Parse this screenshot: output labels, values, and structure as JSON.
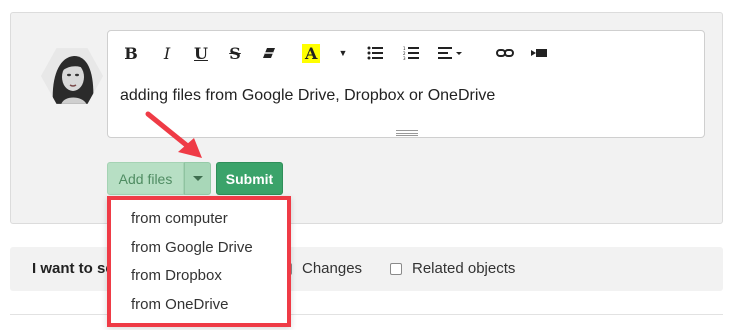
{
  "editor": {
    "text": "adding files from Google Drive, Dropbox or OneDrive",
    "toolbar": {
      "bold": "B",
      "italic": "I",
      "underline": "U",
      "strikethrough": "S",
      "highlight": "A",
      "eraser_icon": "eraser-icon",
      "bulleted_list_icon": "bulleted-list-icon",
      "numbered_list_icon": "numbered-list-icon",
      "align_icon": "align-icon",
      "link_icon": "link-icon",
      "video_icon": "video-icon",
      "highlight_color": "#ffff00"
    }
  },
  "actions": {
    "add_files_label": "Add files",
    "submit_label": "Submit",
    "add_files_color": "#b7dfc4",
    "submit_color": "#3ba36a"
  },
  "dropdown": {
    "items": [
      "from computer",
      "from Google Drive",
      "from Dropbox",
      "from OneDrive"
    ],
    "highlight_border_color": "#ef3b46"
  },
  "filters": {
    "label": "I want to se",
    "options": [
      {
        "label": "Changes",
        "checked": false
      },
      {
        "label": "Related objects",
        "checked": false
      }
    ]
  }
}
